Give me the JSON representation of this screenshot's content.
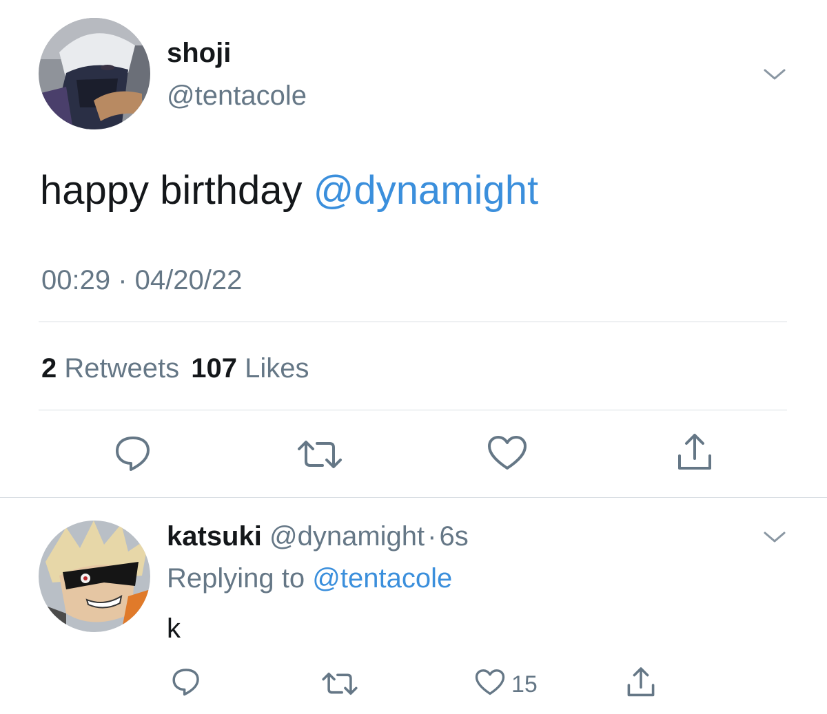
{
  "main_tweet": {
    "display_name": "shoji",
    "handle": "@tentacole",
    "text_prefix": "happy birthday ",
    "text_mention": "@dynamight",
    "timestamp": "00:29 · 04/20/22",
    "retweets_count": "2",
    "retweets_label": "Retweets",
    "likes_count": "107",
    "likes_label": "Likes",
    "icons": [
      "reply-icon",
      "retweet-icon",
      "like-icon",
      "share-icon"
    ]
  },
  "reply_tweet": {
    "display_name": "katsuki",
    "handle": "@dynamight",
    "dot": "·",
    "age": "6s",
    "replying_prefix": "Replying to",
    "replying_mention": "@tentacole",
    "text": "k",
    "like_count": "15",
    "icons": [
      "reply-icon",
      "retweet-icon",
      "like-icon",
      "share-icon"
    ]
  },
  "colors": {
    "text": "#14171a",
    "secondary": "#657786",
    "link": "#3b8fdc",
    "divider": "#d8dde2"
  }
}
